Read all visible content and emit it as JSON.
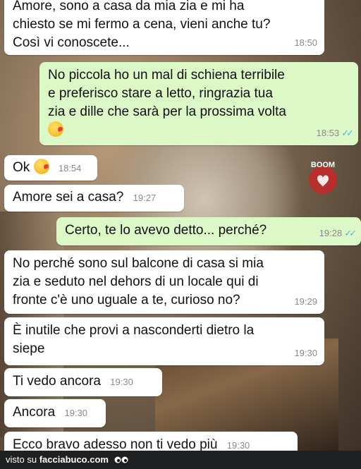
{
  "messages": [
    {
      "type": "in",
      "text_lines": [
        "Amore, sono a casa da mia zia e mi ha",
        "chiesto se mi fermo a cena, vieni anche tu?",
        "Così vi conoscete..."
      ],
      "time": "18:50"
    },
    {
      "type": "out",
      "text_lines": [
        "No piccola ho un mal di schiena terribile",
        "e preferisco stare a letto, ringrazia tua",
        "zia e dille  che sarà per la prossima volta"
      ],
      "emoji": "kiss-emoji",
      "time": "18:53"
    },
    {
      "type": "in",
      "text": "Ok",
      "emoji": "kiss-emoji",
      "time": "18:54"
    },
    {
      "type": "in",
      "text": "Amore sei a casa?",
      "time": "19:27"
    },
    {
      "type": "out",
      "text": "Certo, te lo avevo detto... perché?",
      "time": "19:28"
    },
    {
      "type": "in",
      "text_lines": [
        "No perché sono sul balcone di casa si mia",
        "zia e seduto nel dehors di un locale qui di",
        "fronte c'è uno uguale a te, curioso no?"
      ],
      "time": "19:29"
    },
    {
      "type": "in",
      "text_lines": [
        "È inutile che provi a nasconderti dietro la",
        "siepe"
      ],
      "time": "19:30"
    },
    {
      "type": "in",
      "text": "Ti vedo ancora",
      "time": "19:30"
    },
    {
      "type": "in",
      "text": "Ancora",
      "time": "19:30"
    },
    {
      "type": "in",
      "text": "Ecco bravo adesso non ti vedo più",
      "time": "19:30"
    }
  ],
  "footer": {
    "prefix": "visto su",
    "site": "facciabuco.com"
  },
  "watermark": {
    "text": "BOOM"
  },
  "colors": {
    "incoming": "#ffffff",
    "outgoing": "#dcf8c6",
    "tick": "#4fb6ec",
    "footer_bg": "#1f2021"
  }
}
